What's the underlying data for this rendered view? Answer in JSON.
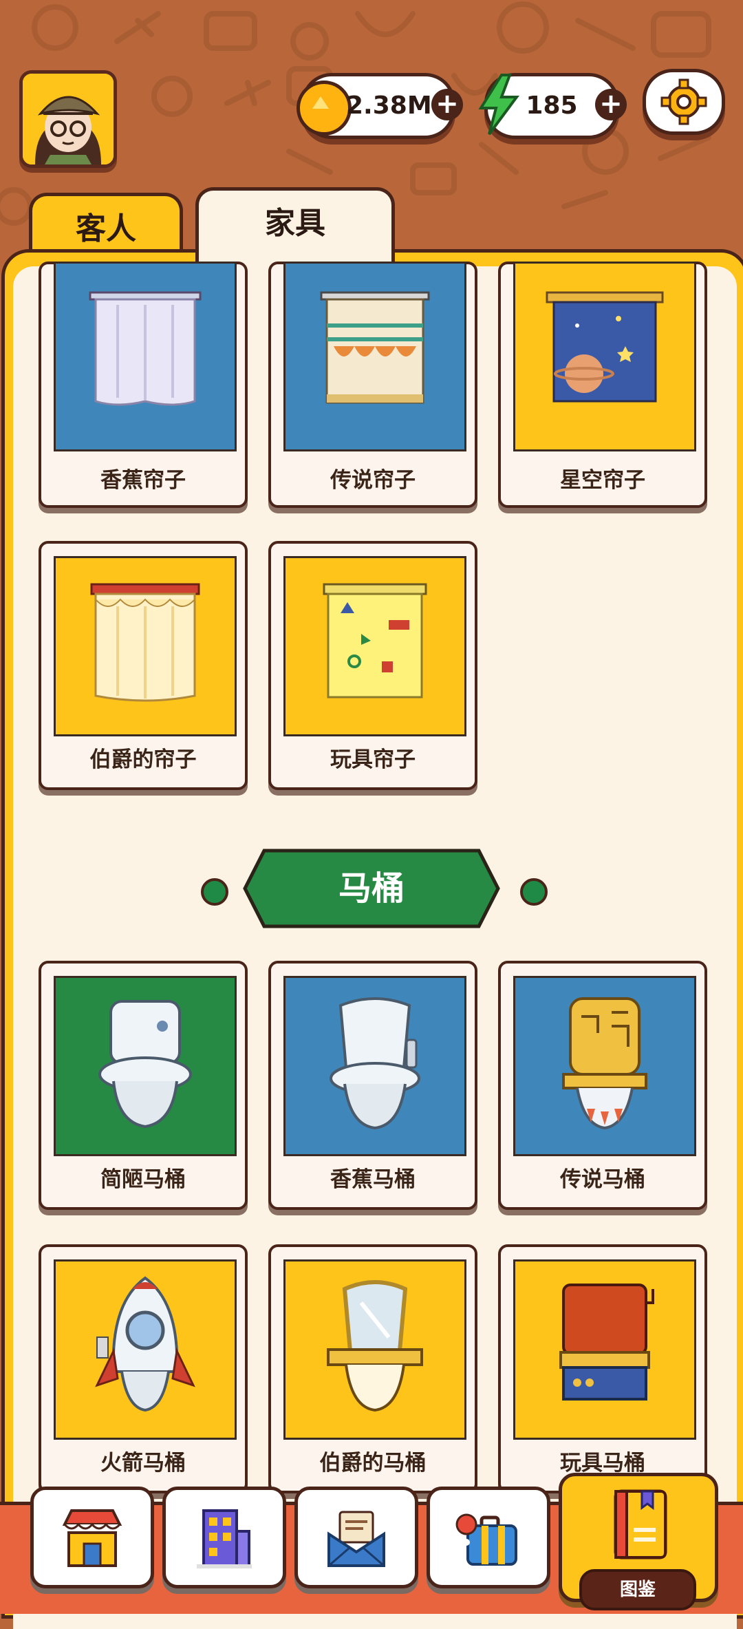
{
  "header": {
    "coins": "2.38M",
    "energy": "185"
  },
  "tabs": [
    {
      "label": "客人"
    },
    {
      "label": "家具"
    }
  ],
  "sections": {
    "curtains": {
      "items": [
        {
          "name": "香蕉帘子",
          "bg": "#3f87ba"
        },
        {
          "name": "传说帘子",
          "bg": "#3f87ba"
        },
        {
          "name": "星空帘子",
          "bg": "#ffc41a"
        },
        {
          "name": "伯爵的帘子",
          "bg": "#ffc41a"
        },
        {
          "name": "玩具帘子",
          "bg": "#ffc41a"
        }
      ]
    },
    "toilets": {
      "title": "马桶",
      "items": [
        {
          "name": "简陋马桶",
          "bg": "#268a45"
        },
        {
          "name": "香蕉马桶",
          "bg": "#3f87ba"
        },
        {
          "name": "传说马桶",
          "bg": "#3f87ba"
        },
        {
          "name": "火箭马桶",
          "bg": "#ffc41a"
        },
        {
          "name": "伯爵的马桶",
          "bg": "#ffc41a"
        },
        {
          "name": "玩具马桶",
          "bg": "#ffc41a"
        }
      ]
    }
  },
  "bottom_nav": {
    "items": [
      {
        "icon": "shop-icon"
      },
      {
        "icon": "building-icon"
      },
      {
        "icon": "mail-icon"
      },
      {
        "icon": "suitcase-icon"
      },
      {
        "icon": "book-icon",
        "label": "图鉴",
        "active": true
      }
    ]
  },
  "colors": {
    "brand_yellow": "#ffc41a",
    "outline": "#4a2418",
    "banner_green": "#268a45",
    "bottom_strip": "#e8643e"
  }
}
